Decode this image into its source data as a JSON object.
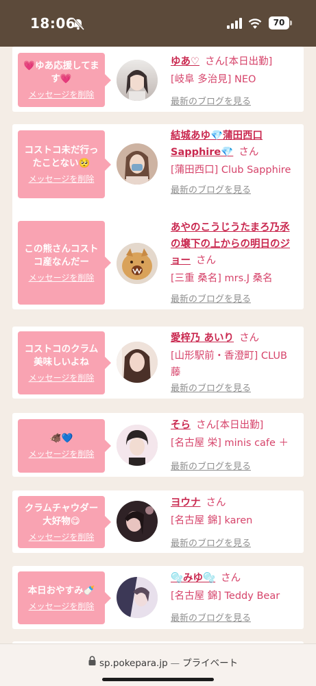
{
  "status_bar": {
    "time": "18:06",
    "battery": "70"
  },
  "cards": [
    {
      "message": "💗ゆあ応援してます💗",
      "delete_label": "メッセージを削除",
      "name": "ゆあ♡",
      "san": "さん",
      "work": "[本日出勤]",
      "shop": "[岐阜 多治見] NEO",
      "blog_link": "最新のブログを見る",
      "avatar_colors": [
        "#e8e4e2",
        "#3a3030"
      ]
    },
    {
      "message": "コストコ未だ行ったことない🥺",
      "delete_label": "メッセージを削除",
      "name": "結城あゆ💎蒲田西口Sapphire💎",
      "san": "さん",
      "work": "",
      "shop": "[蒲田西口] Club Sapphire",
      "blog_link": "最新のブログを見る",
      "avatar_colors": [
        "#d9c0b0",
        "#7aa6c8"
      ]
    },
    {
      "message": "この熊さんコストコ産なんだー",
      "delete_label": "メッセージを削除",
      "name": "あやのこうじうたまろ乃氶の壌下の上からの明日のジョー",
      "san": "さん",
      "work": "",
      "shop": "[三重 桑名] mrs.J 桑名",
      "blog_link": "最新のブログを見る",
      "avatar_colors": [
        "#d9a25a",
        "#7a3b1c"
      ]
    },
    {
      "message": "コストコのクラム美味しいよね",
      "delete_label": "メッセージを削除",
      "name": "愛梓乃 あいり",
      "san": "さん",
      "work": "",
      "shop": "[山形駅前・香澄町] CLUB 藤",
      "blog_link": "最新のブログを見る",
      "avatar_colors": [
        "#e6c8bc",
        "#4a3028"
      ]
    },
    {
      "message": "🐗💙",
      "delete_label": "メッセージを削除",
      "name": "そら",
      "san": "さん",
      "work": "[本日出勤]",
      "shop": "[名古屋 栄] minis cafe ＋",
      "blog_link": "最新のブログを見る",
      "avatar_colors": [
        "#f2e4ea",
        "#2a2424"
      ]
    },
    {
      "message": "クラムチャウダー大好物😋",
      "delete_label": "メッセージを削除",
      "name": "ヨウナ",
      "san": "さん",
      "work": "",
      "shop": "[名古屋 錦] karen",
      "blog_link": "最新のブログを見る",
      "avatar_colors": [
        "#3a2a2e",
        "#d8a8b0"
      ]
    },
    {
      "message": "本日おやすみ🍼",
      "delete_label": "メッセージを削除",
      "name": "🫧みゆ🫧",
      "san": "さん",
      "work": "",
      "shop": "[名古屋 錦] Teddy Bear",
      "blog_link": "最新のブログを見る",
      "avatar_colors": [
        "#3c3856",
        "#e8e0ec"
      ]
    }
  ],
  "url_bar": {
    "domain": "sp.pokepara.jp",
    "separator": "—",
    "mode": "プライベート"
  }
}
